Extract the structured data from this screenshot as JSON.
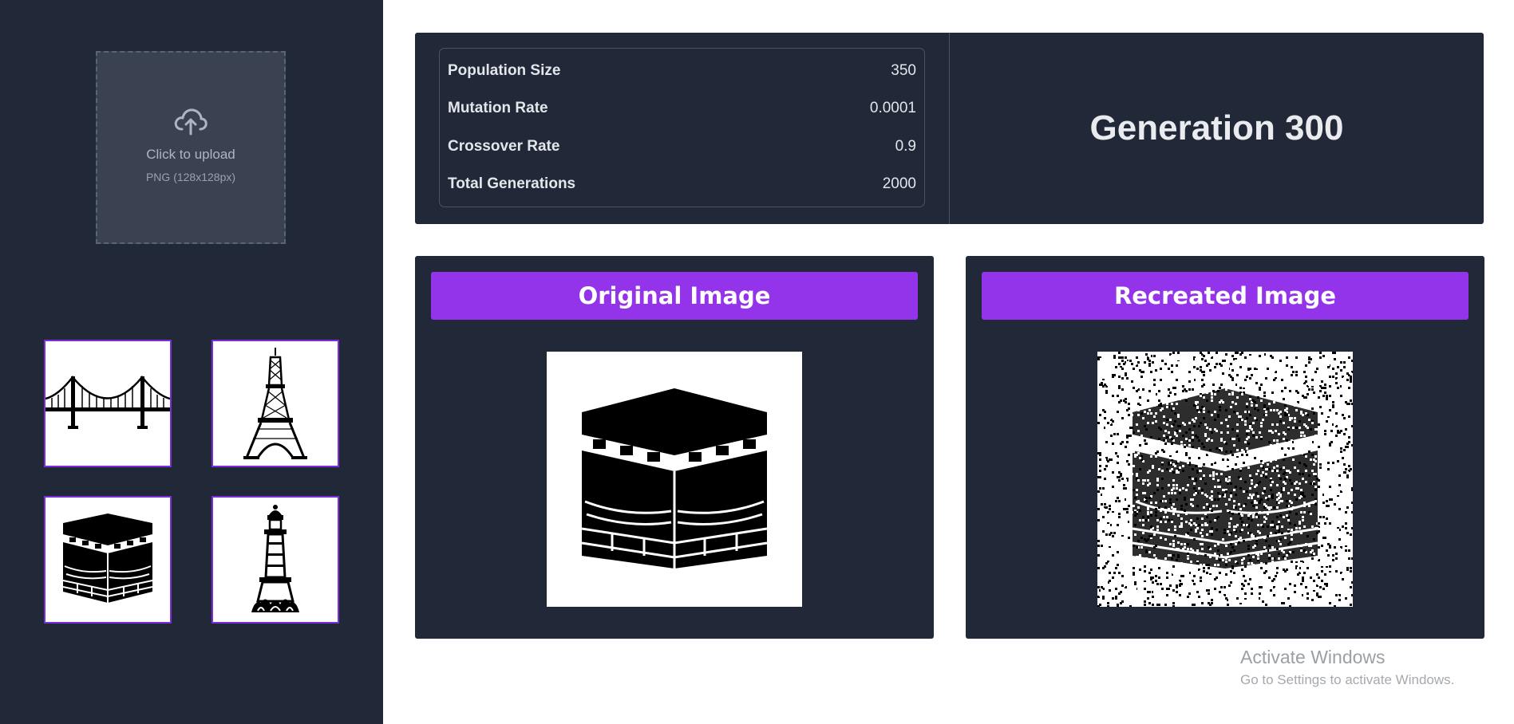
{
  "upload": {
    "title": "Click to upload",
    "subtitle": "PNG (128x128px)",
    "icon": "cloud-upload-icon"
  },
  "samples": [
    {
      "name": "bridge",
      "icon": "bridge-icon"
    },
    {
      "name": "eiffel-tower",
      "icon": "eiffel-tower-icon"
    },
    {
      "name": "kaaba",
      "icon": "kaaba-icon"
    },
    {
      "name": "minar-tower",
      "icon": "minar-tower-icon"
    }
  ],
  "params": [
    {
      "label": "Population Size",
      "value": "350"
    },
    {
      "label": "Mutation Rate",
      "value": "0.0001"
    },
    {
      "label": "Crossover Rate",
      "value": "0.9"
    },
    {
      "label": "Total Generations",
      "value": "2000"
    }
  ],
  "generation": "Generation 300",
  "original": {
    "title": "Original Image"
  },
  "recreated": {
    "title": "Recreated Image"
  },
  "watermark": {
    "title": "Activate Windows",
    "subtitle": "Go to Settings to activate Windows."
  },
  "colors": {
    "sidebar": "#212938",
    "panel": "#212938",
    "accent": "#9333ea",
    "thumb_border": "#7b2ed6"
  }
}
